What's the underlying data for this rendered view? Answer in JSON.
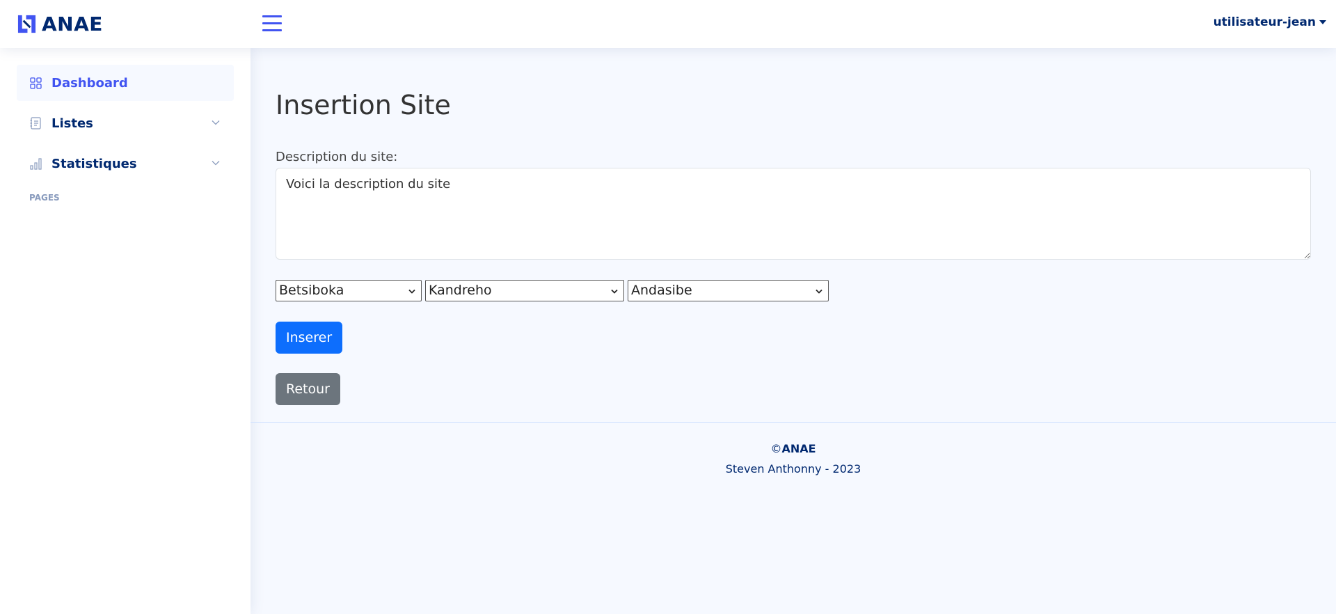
{
  "header": {
    "brand": "ANAE",
    "user_name": "utilisateur-jean"
  },
  "sidebar": {
    "items": [
      {
        "label": "Dashboard",
        "icon": "grid-icon",
        "active": true
      },
      {
        "label": "Listes",
        "icon": "journal-text-icon",
        "expandable": true
      },
      {
        "label": "Statistiques",
        "icon": "bar-chart-icon",
        "expandable": true
      }
    ],
    "heading": "Pages"
  },
  "main": {
    "title": "Insertion Site",
    "description_label": "Description du site:",
    "description_value": "Voici la description du site",
    "selects": [
      {
        "value": "Betsiboka"
      },
      {
        "value": "Kandreho"
      },
      {
        "value": "Andasibe"
      }
    ],
    "insert_label": "Inserer",
    "back_label": "Retour"
  },
  "footer": {
    "copyright_symbol": "©",
    "copyright_brand": "ANAE",
    "credit": "Steven Anthonny - 2023"
  },
  "colors": {
    "accent": "#4154f1",
    "navy": "#012970",
    "primary_button": "#0d6efd",
    "secondary_button": "#6c757d",
    "background": "#f6f9ff"
  }
}
